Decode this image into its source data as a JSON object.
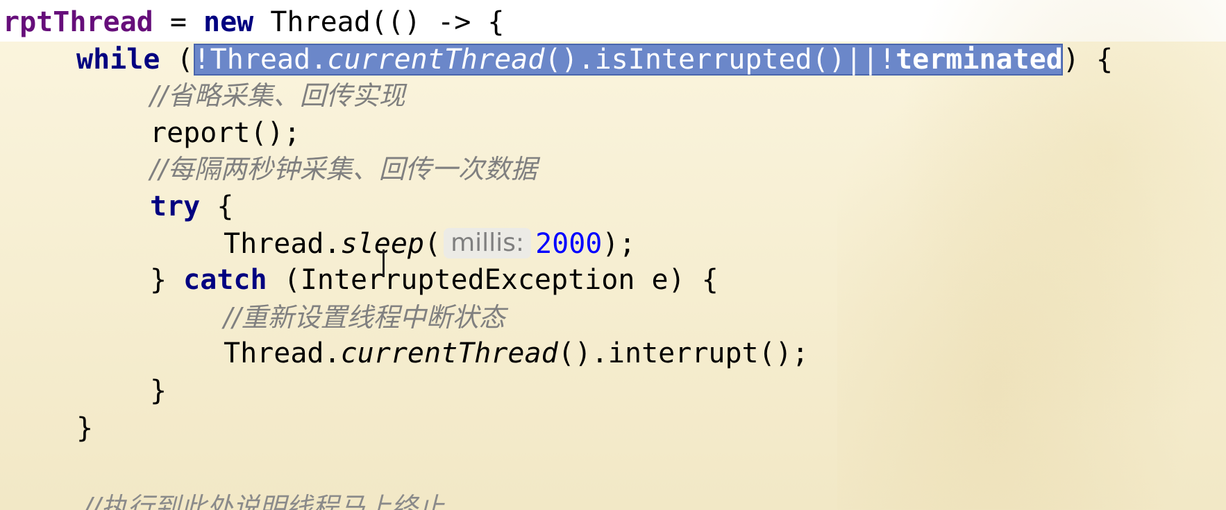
{
  "code": {
    "line1": {
      "var": "rptThread",
      "op": " = ",
      "kw_new": "new",
      "rest": " Thread(() -> {"
    },
    "line2": {
      "kw_while": "while",
      "open": " (",
      "sel_a": "!Thread.",
      "sel_b": "currentThread",
      "sel_c": "().isInterrupted()||!",
      "sel_d": "terminated",
      "close": ") {"
    },
    "line3": {
      "comment": "//省略采集、回传实现"
    },
    "line4": {
      "text": "report();"
    },
    "line5": {
      "comment": "//每隔两秒钟采集、回传一次数据"
    },
    "line6": {
      "kw_try": "try",
      "rest": " {"
    },
    "line7": {
      "pre": "Thread.",
      "method": "sleep",
      "paren": "(",
      "hint": "millis:",
      "num": "2000",
      "end": ");"
    },
    "line8": {
      "pre": "} ",
      "kw_catch": "catch",
      "rest": " (InterruptedException e) {"
    },
    "line9": {
      "comment": "//重新设置线程中断状态"
    },
    "line10": {
      "pre": "Thread.",
      "method": "currentThread",
      "end": "().interrupt();"
    },
    "line11": {
      "text": "}"
    },
    "line12": {
      "text": "}"
    },
    "line13": {
      "comment": "//执行到此处说明线程马上终止"
    }
  },
  "colors": {
    "keyword": "#000080",
    "comment": "#808080",
    "number": "#0000ff",
    "selection": "#6b87c9",
    "background": "#f6eed1"
  }
}
